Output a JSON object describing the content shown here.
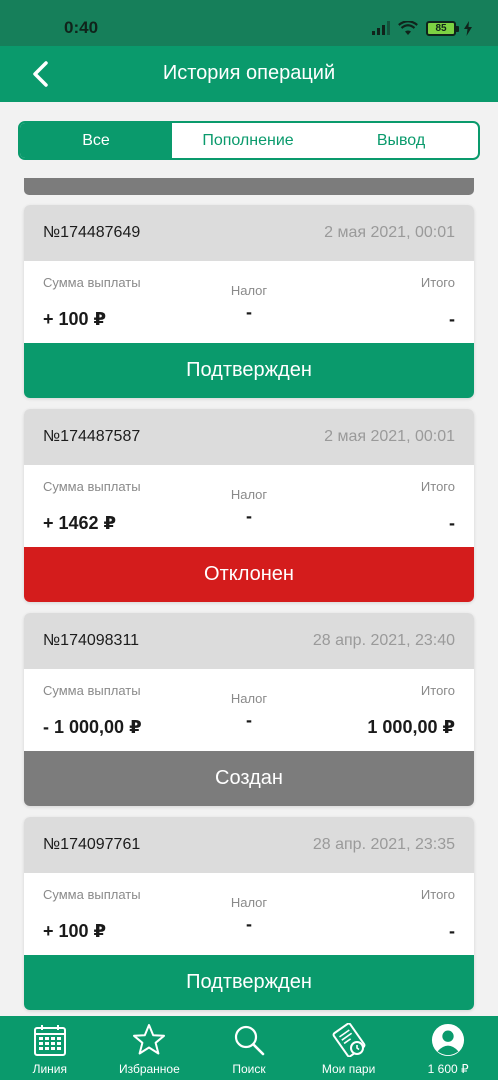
{
  "status_bar": {
    "time": "0:40",
    "battery": "85"
  },
  "header": {
    "title": "История операций"
  },
  "tabs": [
    {
      "label": "Все",
      "active": true
    },
    {
      "label": "Пополнение",
      "active": false
    },
    {
      "label": "Вывод",
      "active": false
    }
  ],
  "labels": {
    "sum": "Сумма выплаты",
    "tax": "Налог",
    "total": "Итого"
  },
  "operations": [
    {
      "id": "№174487649",
      "date": "2 мая 2021, 00:01",
      "sum": "+ 100 ₽",
      "tax": "-",
      "total": "-",
      "status": "Подтвержден",
      "status_color": "#0a9a6c"
    },
    {
      "id": "№174487587",
      "date": "2 мая 2021, 00:01",
      "sum": "+ 1462 ₽",
      "tax": "-",
      "total": "-",
      "status": "Отклонен",
      "status_color": "#d41c1c"
    },
    {
      "id": "№174098311",
      "date": "28 апр. 2021, 23:40",
      "sum": "- 1 000,00 ₽",
      "tax": "-",
      "total": "1 000,00 ₽",
      "status": "Создан",
      "status_color": "#7c7c7c"
    },
    {
      "id": "№174097761",
      "date": "28 апр. 2021, 23:35",
      "sum": "+ 100 ₽",
      "tax": "-",
      "total": "-",
      "status": "Подтвержден",
      "status_color": "#0a9a6c"
    }
  ],
  "bottom_nav": [
    {
      "label": "Линия",
      "icon": "calendar-icon"
    },
    {
      "label": "Избранное",
      "icon": "star-icon"
    },
    {
      "label": "Поиск",
      "icon": "search-icon"
    },
    {
      "label": "Мои пари",
      "icon": "ticket-icon"
    },
    {
      "label": "1 600 ₽",
      "icon": "profile-icon"
    }
  ],
  "colors": {
    "brand": "#0a9a6c",
    "status_bar": "#167f5a",
    "rejected": "#d41c1c",
    "created": "#7c7c7c"
  }
}
